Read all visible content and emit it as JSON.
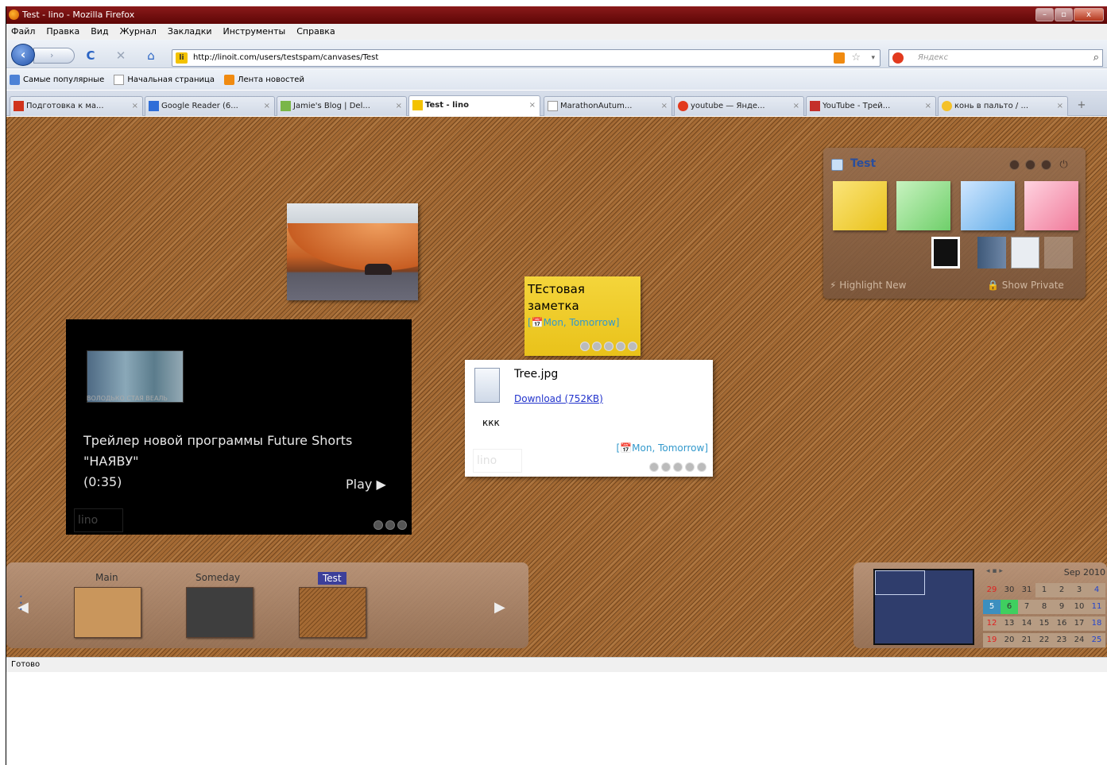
{
  "window": {
    "title": "Test - lino - Mozilla Firefox",
    "min": "–",
    "max": "▫",
    "close": "x"
  },
  "menu": [
    "Файл",
    "Правка",
    "Вид",
    "Журнал",
    "Закладки",
    "Инструменты",
    "Справка"
  ],
  "nav": {
    "url": "http://linoit.com/users/testspam/canvases/Test",
    "search_placeholder": "Яндекс",
    "site_badge": "li",
    "back": "‹",
    "forward": "›",
    "reload": "C",
    "stop": "✕",
    "home": "⌂",
    "star": "☆",
    "dropdown": "▾",
    "search_glyph": "⌕"
  },
  "bookmarks": [
    "Самые популярные",
    "Начальная страница",
    "Лента новостей"
  ],
  "tabs": [
    {
      "label": "Подготовка к ма...",
      "close": "×",
      "icon_color": "#d0331c"
    },
    {
      "label": "Google Reader (6...",
      "close": "×",
      "icon_color": "#2f6ed8"
    },
    {
      "label": "Jamie's Blog | Del...",
      "close": "×",
      "icon_color": "#7ab648"
    },
    {
      "label": "Test - lino",
      "close": "×",
      "icon_color": "#f3c200"
    },
    {
      "label": "MarathonAutum...",
      "close": "×",
      "icon_color": "#ffffff"
    },
    {
      "label": "youtube — Янде...",
      "close": "×",
      "icon_color": "#e23a1e"
    },
    {
      "label": "YouTube - Трей...",
      "close": "×",
      "icon_color": "#c4302b"
    },
    {
      "label": "конь в пальто / ...",
      "close": "×",
      "icon_color": "#f4c12a"
    }
  ],
  "tab_plus": "+",
  "status": "Готово",
  "sticky": {
    "text": "ТЕстовая заметка",
    "date": "[📅Mon, Tomorrow]"
  },
  "file_card": {
    "filename": "Tree.jpg",
    "link": "Download (752KB)",
    "note": "ккк",
    "date": "[📅Mon, Tomorrow]"
  },
  "video": {
    "caption": "ВОЛОДЬКО СТАЯ ВЕАЛЬ",
    "line1": "Трейлер новой программы Future Shorts",
    "line2": "\"НАЯВУ\"",
    "line3": "(0:35)",
    "play": "Play ▶"
  },
  "lino_mark": "lino",
  "panel": {
    "title": "Test",
    "highlight": "⚡ Highlight New",
    "show_private": "🔒 Show Private"
  },
  "boards": [
    {
      "name": "Main",
      "active": false
    },
    {
      "name": "Someday",
      "active": false
    },
    {
      "name": "Test",
      "active": true
    }
  ],
  "boardbar": {
    "prev": "◀",
    "next": "▶"
  },
  "calendar": {
    "month": "Sep 2010",
    "nav": "◂ ▪ ▸",
    "weeks": [
      [
        "29",
        "30",
        "31",
        "1",
        "2",
        "3",
        "4"
      ],
      [
        "5",
        "6",
        "7",
        "8",
        "9",
        "10",
        "11"
      ],
      [
        "12",
        "13",
        "14",
        "15",
        "16",
        "17",
        "18"
      ],
      [
        "19",
        "20",
        "21",
        "22",
        "23",
        "24",
        "25"
      ]
    ]
  }
}
